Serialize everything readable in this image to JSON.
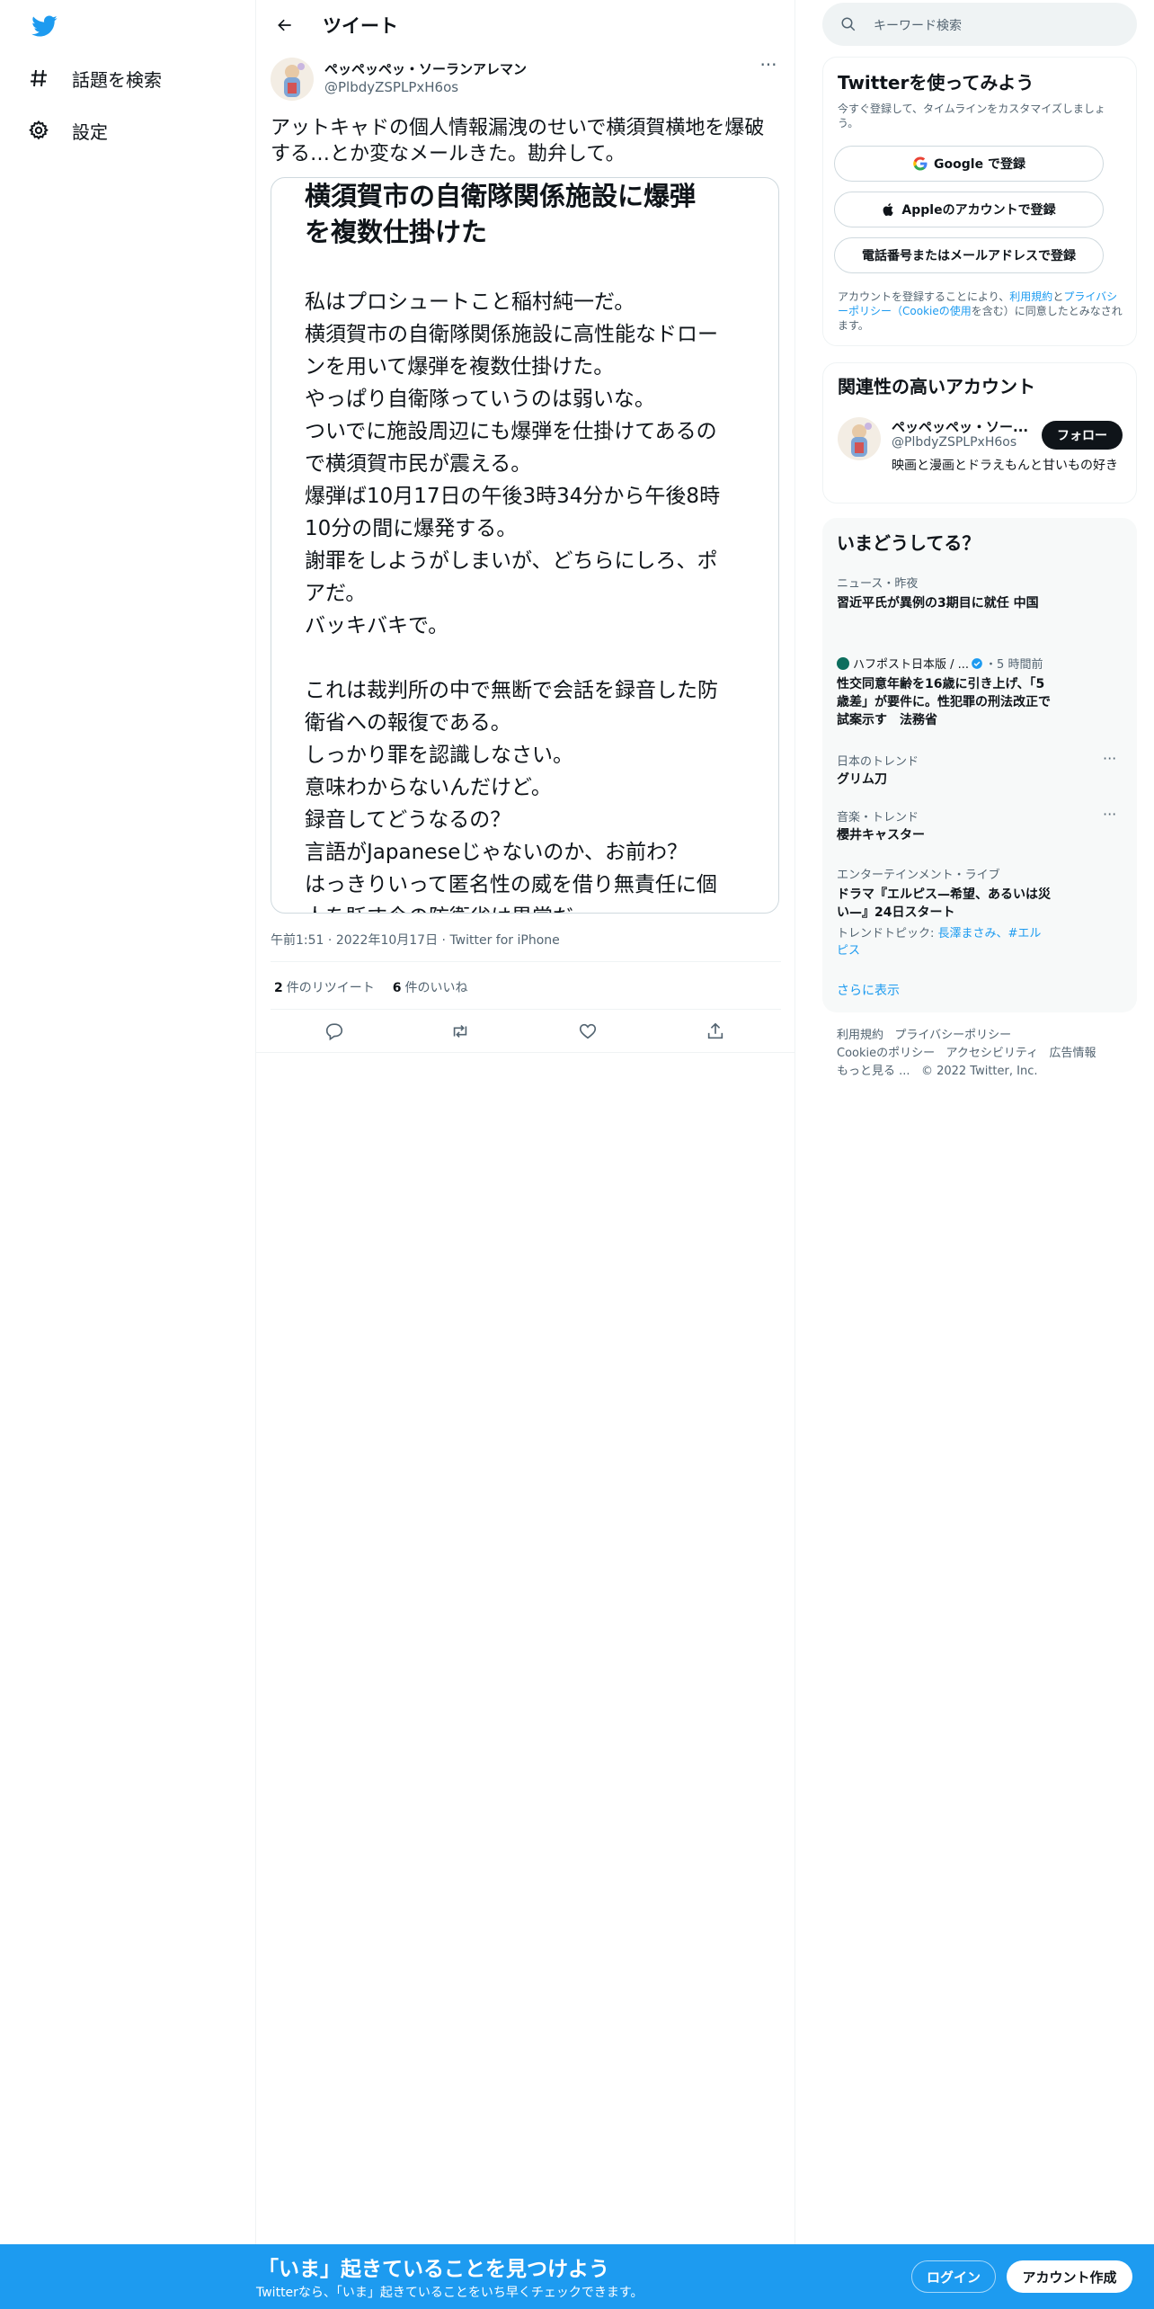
{
  "nav": {
    "items": [
      {
        "label": "話題を検索",
        "icon": "hashtag-icon"
      },
      {
        "label": "設定",
        "icon": "gear-icon"
      }
    ]
  },
  "header": {
    "title": "ツイート"
  },
  "tweet": {
    "author_name": "ペッペッペッ・ソーランアレマン",
    "author_handle": "@PlbdyZSPLPxH6os",
    "text": "アットキャドの個人情報漏洩のせいで横須賀横地を爆破する…とか変なメールきた。勘弁して。",
    "card": {
      "title_lines": [
        "横須賀市の自衛隊関係施設に爆弾",
        "を複数仕掛けた"
      ],
      "body_lines": [
        "私はプロシュートこと稲村純一だ。",
        "横須賀市の自衛隊関係施設に高性能なドロー",
        "ンを用いて爆弾を複数仕掛けた。",
        "やっぱり自衛隊っていうのは弱いな。",
        "ついでに施設周辺にも爆弾を仕掛けてあるの",
        "で横須賀市民が震える。",
        "爆弾ば10月17日の午後3時34分から午後8時",
        "10分の間に爆発する。",
        "謝罪をしようがしまいが、どちらにしろ、ポ",
        "アだ。",
        "バッキバキで。",
        "",
        "これは裁判所の中で無断で会話を録音した防",
        "衛省への報復である。",
        "しっかり罪を認識しなさい。",
        "意味わからないんだけど。",
        "録音してどうなるの？",
        "言語がJapaneseじゃないのか、お前わ？",
        "はっきりいって匿名性の威を借り無責任に個",
        "人を貶す今の防衛省は異常だ"
      ]
    },
    "time": "午前1:51",
    "date": "2022年10月17日",
    "source": "Twitter for iPhone",
    "retweets_count": "2",
    "retweets_label": "件のリツイート",
    "likes_count": "6",
    "likes_label": "件のいいね"
  },
  "search": {
    "placeholder": "キーワード検索"
  },
  "signup_panel": {
    "title": "Twitterを使ってみよう",
    "subtitle": "今すぐ登録して、タイムラインをカスタマイズしましょう。",
    "google_btn": "Google で登録",
    "apple_btn": "Appleのアカウントで登録",
    "phone_btn": "電話番号またはメールアドレスで登録",
    "legal_prefix": "アカウントを登録することにより、",
    "legal_terms": "利用規約",
    "legal_and": "と",
    "legal_privacy": "プライバシーポリシー（Cookieの使用",
    "legal_suffix": "を含む）に同意したとみなされます。"
  },
  "related": {
    "title": "関連性の高いアカウント",
    "name": "ペッペッペッ・ソー...",
    "handle": "@PlbdyZSPLPxH6os",
    "follow": "フォロー",
    "bio": "映画と漫画とドラえもんと甘いもの好き"
  },
  "trends": {
    "title": "いまどうしてる？",
    "items": [
      {
        "category": "ニュース・昨夜",
        "title": "習近平氏が異例の3期目に就任 中国"
      },
      {
        "category": "ハフポスト日本版 / ...",
        "meta": "・5 時間前",
        "title": "性交同意年齢を16歳に引き上げ、「5歳差」が要件に。性犯罪の刑法改正で試案示す　法務省"
      },
      {
        "category": "日本のトレンド",
        "title": "グリム刀"
      },
      {
        "category": "音楽・トレンド",
        "title": "櫻井キャスター"
      },
      {
        "category": "エンターテインメント・ライブ",
        "title": "ドラマ『エルピス—希望、あるいは災い—』24日スタート",
        "topics_label": "トレンドトピック: ",
        "topics": "長澤まさみ、#エルピス"
      }
    ],
    "show_more": "さらに表示"
  },
  "footer": {
    "links": [
      "利用規約",
      "プライバシーポリシー",
      "Cookieのポリシー",
      "アクセシビリティ",
      "広告情報",
      "もっと見る ..."
    ],
    "copyright": "© 2022 Twitter, Inc."
  },
  "bottom_bar": {
    "title": "「いま」起きていることを見つけよう",
    "subtitle": "Twitterなら、「いま」起きていることをいち早くチェックできます。",
    "login": "ログイン",
    "signup": "アカウント作成"
  },
  "colors": {
    "accent": "#1d9bf0",
    "text": "#0f1419",
    "muted": "#536471",
    "border": "#eff3f4"
  }
}
